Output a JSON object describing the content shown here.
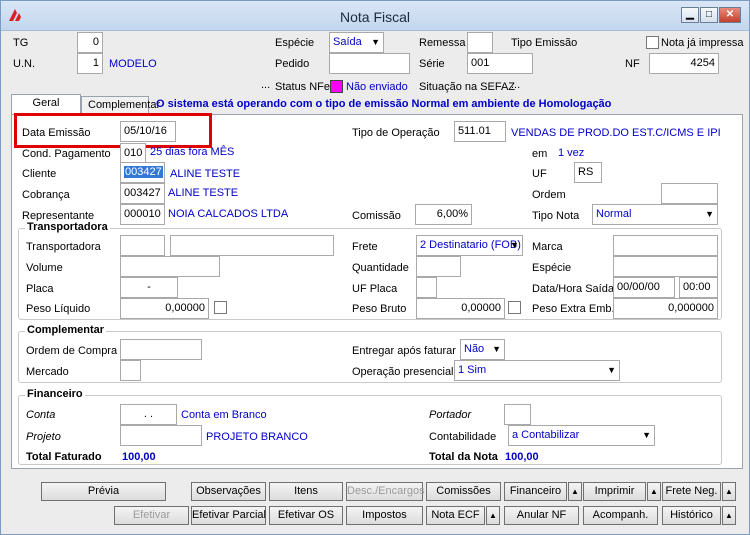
{
  "window": {
    "title": "Nota Fiscal"
  },
  "header": {
    "tg_label": "TG",
    "tg_value": "0",
    "un_label": "U.N.",
    "un_value": "1",
    "un_name": "MODELO",
    "especie_label": "Espécie",
    "especie_value": "Saída",
    "remessa_label": "Remessa",
    "tipo_emissao_label": "Tipo Emissão",
    "nota_ja_impressa_label": "Nota já impressa",
    "pedido_label": "Pedido",
    "serie_label": "Série",
    "serie_value": "001",
    "nf_label": "NF",
    "nf_value": "4254",
    "ellipsis1": "...",
    "status_nfe_label": "Status NFe",
    "status_nfe_value": "Não enviado",
    "situacao_label": "Situação na SEFAZ",
    "ellipsis2": "..."
  },
  "tabs": [
    {
      "label": "Geral"
    },
    {
      "label": "Complementar"
    }
  ],
  "banner": "O sistema está operando com o tipo de emissão Normal em ambiente de Homologação",
  "geral": {
    "data_emissao_label": "Data Emissão",
    "data_emissao_value": "05/10/16",
    "tipo_operacao_label": "Tipo de Operação",
    "tipo_operacao_value": "511.01",
    "tipo_operacao_desc": "VENDAS DE PROD.DO EST.C/ICMS E IPI",
    "cond_pagamento_label": "Cond. Pagamento",
    "cond_pagamento_value": "010",
    "cond_pagamento_desc": "25 dias fora MÊS",
    "em_label": "em",
    "em_value": "1 vez",
    "cliente_label": "Cliente",
    "cliente_value": "003427",
    "cliente_name": "ALINE TESTE",
    "uf_label": "UF",
    "uf_value": "RS",
    "cobranca_label": "Cobrança",
    "cobranca_value": "003427",
    "cobranca_name": "ALINE TESTE",
    "ordem_label": "Ordem",
    "representante_label": "Representante",
    "representante_value": "000010",
    "representante_name": "NOIA CALCADOS LTDA",
    "comissao_label": "Comissão",
    "comissao_value": "6,00%",
    "tipo_nota_label": "Tipo Nota",
    "tipo_nota_value": "Normal"
  },
  "transportadora": {
    "title": "Transportadora",
    "transportadora_label": "Transportadora",
    "frete_label": "Frete",
    "frete_value": "2 Destinatario (FOB)",
    "marca_label": "Marca",
    "volume_label": "Volume",
    "quantidade_label": "Quantidade",
    "especie_label": "Espécie",
    "placa_label": "Placa",
    "placa_value": "-",
    "uf_placa_label": "UF Placa",
    "data_hora_saida_label": "Data/Hora Saída",
    "data_saida_value": "00/00/00",
    "hora_saida_value": "00:00",
    "peso_liquido_label": "Peso Líquido",
    "peso_liquido_value": "0,00000",
    "peso_bruto_label": "Peso Bruto",
    "peso_bruto_value": "0,00000",
    "peso_extra_label": "Peso Extra Emb.",
    "peso_extra_value": "0,000000"
  },
  "complementar": {
    "title": "Complementar",
    "ordem_compra_label": "Ordem de Compra",
    "entregar_label": "Entregar após faturar",
    "entregar_value": "Não",
    "mercado_label": "Mercado",
    "operacao_presencial_label": "Operação presencial",
    "operacao_presencial_value": "1 Sim"
  },
  "financeiro": {
    "title": "Financeiro",
    "conta_label": "Conta",
    "conta_value": ". .",
    "conta_desc": "Conta em Branco",
    "portador_label": "Portador",
    "projeto_label": "Projeto",
    "projeto_desc": "PROJETO BRANCO",
    "contabilidade_label": "Contabilidade",
    "contabilidade_value": "a Contabilizar",
    "total_faturado_label": "Total Faturado",
    "total_faturado_value": "100,00",
    "total_nota_label": "Total da Nota",
    "total_nota_value": "100,00"
  },
  "buttons": {
    "previa": "Prévia",
    "observacoes": "Observações",
    "itens": "Itens",
    "desc_encargos": "Desc./Encargos",
    "comissoes": "Comissões",
    "financeiro": "Financeiro",
    "imprimir": "Imprimir",
    "frete_neg": "Frete Neg.",
    "efetivar": "Efetivar",
    "efetivar_parcial": "Efetivar Parcial",
    "efetivar_os": "Efetivar OS",
    "impostos": "Impostos",
    "nota_ecf": "Nota ECF",
    "anular_nf": "Anular NF",
    "acompanh": "Acompanh.",
    "historico": "Histórico"
  }
}
